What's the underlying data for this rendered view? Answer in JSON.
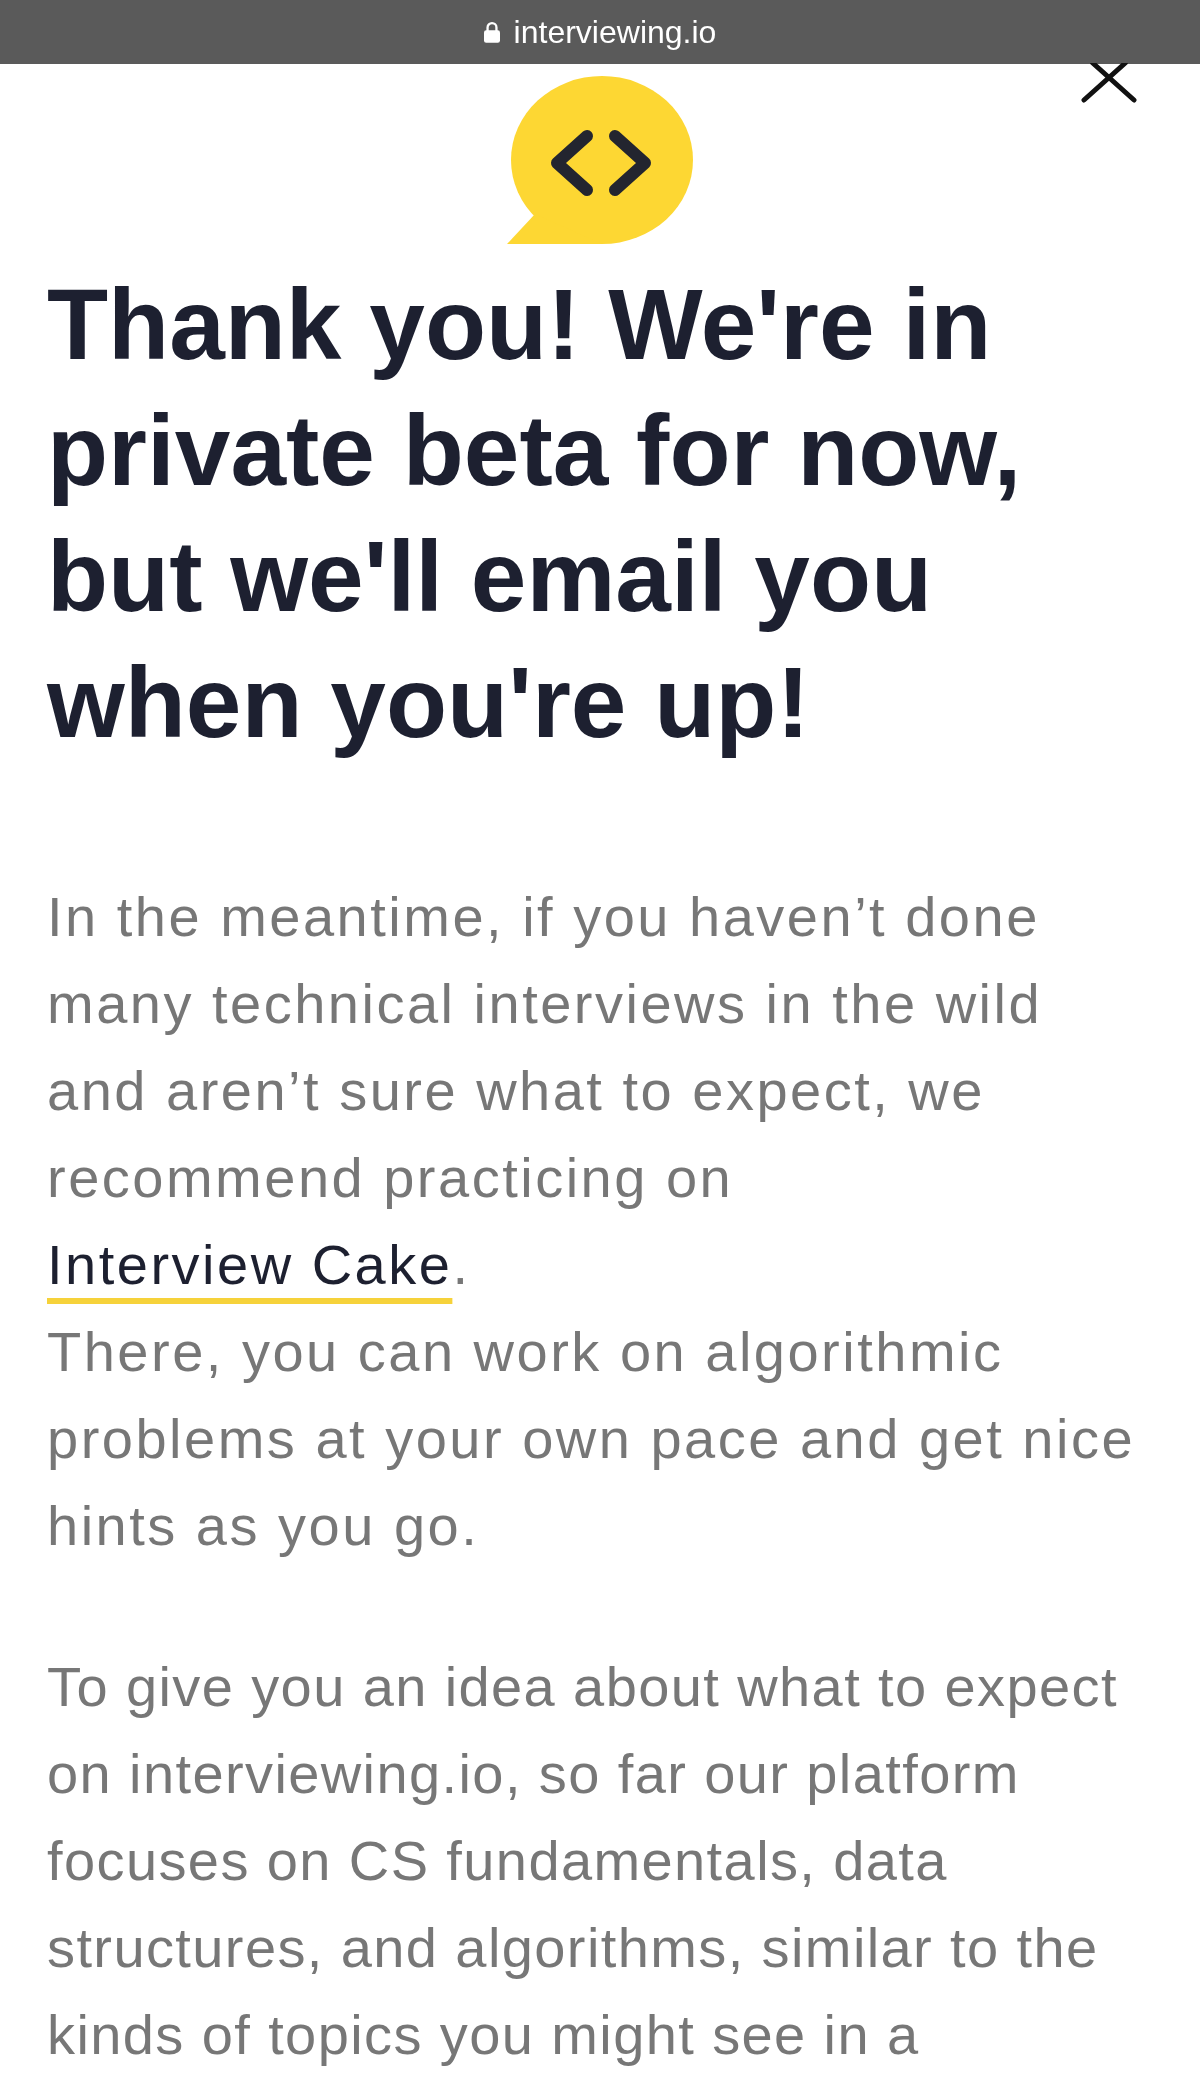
{
  "address_bar": {
    "url": "interviewing.io"
  },
  "heading": "Thank you! We're in private beta for now, but we'll email you when you're up!",
  "sections": [
    {
      "paragraphs": [
        {
          "text": "In the meantime, if you haven’t done many technical interviews in the wild and aren’t sure what to expect, we recommend practicing on",
          "link": "Interview Cake",
          "after_link": "."
        },
        {
          "text": "There, you can work on algorithmic problems at your own pace and get nice hints as you go."
        }
      ]
    },
    {
      "paragraphs": [
        {
          "text": "To give you an idea about what to expect on interviewing.io, so far our platform focuses on CS fundamentals, data structures, and algorithms, similar to the kinds of topics you might see in a"
        }
      ]
    }
  ]
}
